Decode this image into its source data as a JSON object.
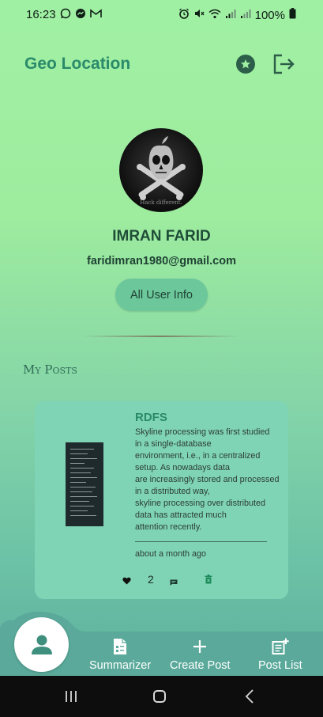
{
  "status_bar": {
    "time": "16:23",
    "left_icons": [
      "whatsapp-icon",
      "messenger-icon",
      "gmail-icon"
    ],
    "right_icons": [
      "alarm-icon",
      "mute-icon",
      "wifi-icon",
      "signal-icon",
      "signal-icon",
      "battery-icon"
    ],
    "battery": "100%"
  },
  "app_bar": {
    "title": "Geo Location",
    "actions": [
      "star-icon",
      "logout-icon"
    ]
  },
  "profile": {
    "name": "IMRAN FARID",
    "email": "faridimran1980@gmail.com",
    "info_button": "All User Info",
    "avatar_caption": "Hack different."
  },
  "section": {
    "title": "My Posts"
  },
  "post": {
    "title": "RDFS",
    "body_lines": [
      "Skyline processing was first studied",
      "in a single-database",
      "environment, i.e., in a centralized",
      "setup. As nowadays data",
      "are increasingly stored and processed",
      "in a distributed way,",
      "skyline processing over distributed",
      "data has attracted much",
      "attention recently."
    ],
    "time": "about a month ago",
    "likes": "2"
  },
  "bottom_nav": {
    "items": [
      {
        "icon": "summarizer-icon",
        "label": "Summarizer"
      },
      {
        "icon": "plus-icon",
        "label": "Create Post"
      },
      {
        "icon": "post-list-icon",
        "label": "Post List"
      }
    ],
    "fab_icon": "person-icon"
  },
  "colors": {
    "accent": "#2a8a6a",
    "background_top": "#a0f0a4",
    "background_bottom": "#5aa99a",
    "card": "#7fd4b6",
    "system_nav": "#0d0d0d"
  }
}
